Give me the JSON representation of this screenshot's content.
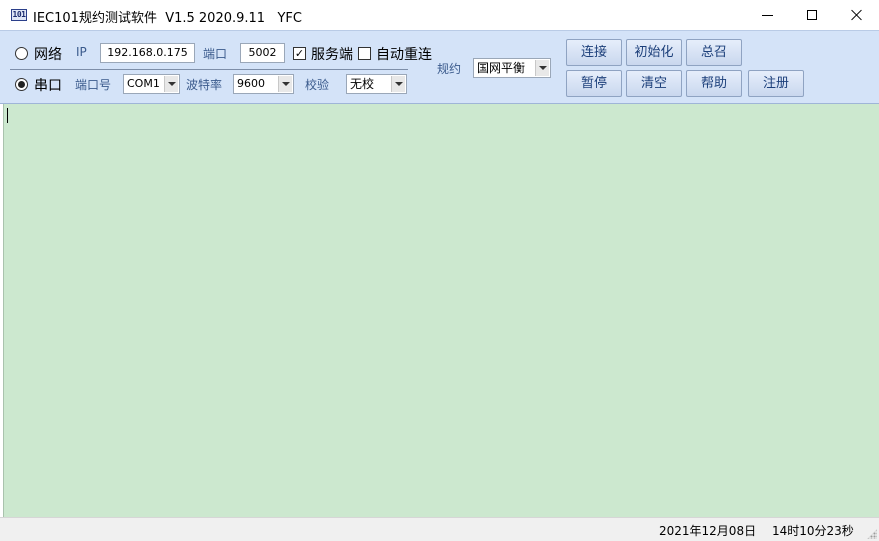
{
  "window": {
    "title": "IEC101规约测试软件  V1.5 2020.9.11   YFC",
    "icon_text": "101",
    "icon": "app-101-icon",
    "controls": [
      "minimize-icon",
      "maximize-icon",
      "close-icon"
    ]
  },
  "network": {
    "radio_label": "网络",
    "selected": false,
    "ip_label": "IP",
    "ip_value": "192.168.0.175",
    "port_label": "端口",
    "port_value": "5002",
    "server_checked": true,
    "server_label": "服务端",
    "reconnect_checked": false,
    "reconnect_label": "自动重连"
  },
  "serial": {
    "radio_label": "串口",
    "selected": true,
    "port_label": "端口号",
    "port_value": "COM1",
    "baud_label": "波特率",
    "baud_value": "9600",
    "parity_label": "校验",
    "parity_value": "无校"
  },
  "protocol": {
    "label": "规约",
    "value": "国网平衡"
  },
  "buttons": {
    "connect": "连接",
    "init": "初始化",
    "general_call": "总召",
    "pause": "暂停",
    "clear": "清空",
    "help": "帮助",
    "register": "注册"
  },
  "status": {
    "date": "2021年12月08日",
    "time": "14时10分23秒"
  },
  "colors": {
    "toolbar_bg": "#d4e3f8",
    "log_bg": "#cce8cf",
    "button_text": "#1c3f7a"
  }
}
